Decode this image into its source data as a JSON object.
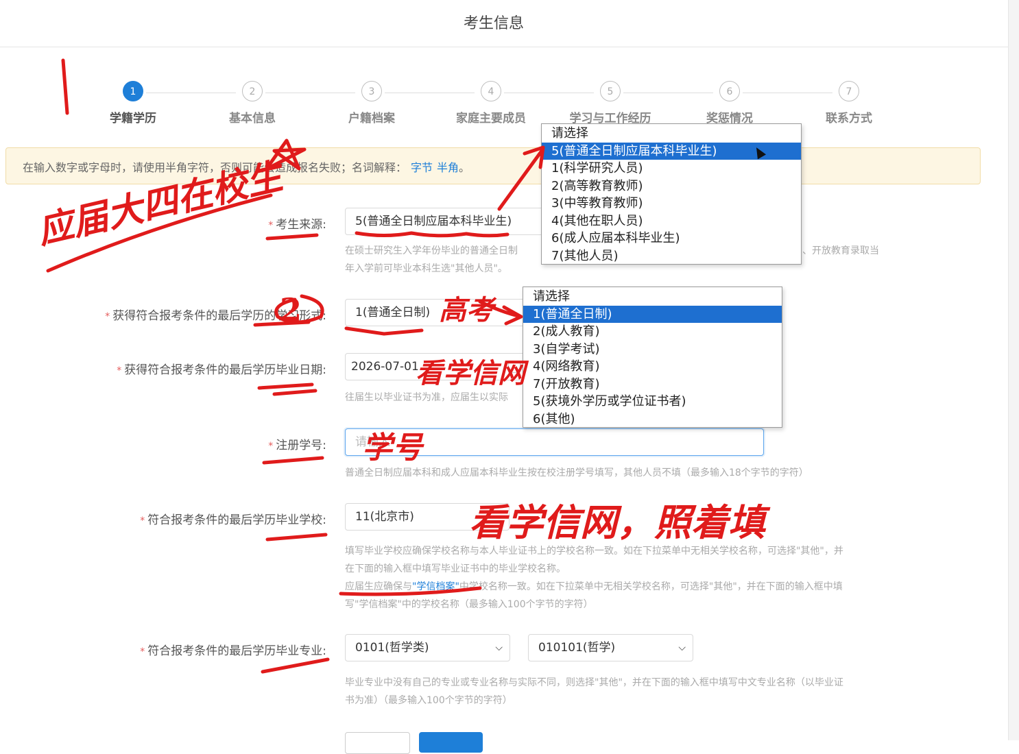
{
  "header": {
    "title": "考生信息"
  },
  "steps": [
    {
      "num": "1",
      "label": "学籍学历",
      "active": true
    },
    {
      "num": "2",
      "label": "基本信息",
      "active": false
    },
    {
      "num": "3",
      "label": "户籍档案",
      "active": false
    },
    {
      "num": "4",
      "label": "家庭主要成员",
      "active": false
    },
    {
      "num": "5",
      "label": "学习与工作经历",
      "active": false
    },
    {
      "num": "6",
      "label": "奖惩情况",
      "active": false
    },
    {
      "num": "7",
      "label": "联系方式",
      "active": false
    }
  ],
  "notice": {
    "text": "在输入数字或字母时，请使用半角字符，否则可能会造成报名失败；名词解释：",
    "link1": "字节",
    "link2": "半角",
    "end": "。"
  },
  "form": {
    "source": {
      "label": "考生来源:",
      "value": "5(普通全日制应届本科毕业生)",
      "hint_line1": "在硕士研究生入学年份毕业的普通全日制",
      "hint_line1_tail": "、开放教育录取当",
      "hint_line2": "年入学前可毕业本科生选\"其他人员\"。"
    },
    "study_form": {
      "label": "获得符合报考条件的最后学历的学习形式:",
      "value": "1(普通全日制)"
    },
    "grad_date": {
      "label": "获得符合报考条件的最后学历毕业日期:",
      "value": "2026-07-01",
      "hint": "往届生以毕业证书为准，应届生以实际"
    },
    "reg_no": {
      "label": "注册学号:",
      "placeholder": "请输入",
      "hint": "普通全日制应届本科和成人应届本科毕业生按在校注册学号填写，其他人员不填（最多输入18个字节的字符）"
    },
    "school": {
      "label": "符合报考条件的最后学历毕业学校:",
      "value": "11(北京市)",
      "hint_line1": "填写毕业学校应确保学校名称与本人毕业证书上的学校名称一致。如在下拉菜单中无相关学校名称，可选择\"其他\"，并",
      "hint_line2": "在下面的输入框中填写毕业证书中的毕业学校名称。",
      "hint_line3_pre": "应届生应确保与",
      "hint_line3_link": "\"学信档案\"",
      "hint_line3_post": "中学校名称一致。如在下拉菜单中无相关学校名称，可选择\"其他\"，并在下面的输入框中填",
      "hint_line4": "写\"学信档案\"中的学校名称（最多输入100个字节的字符）"
    },
    "major": {
      "label": "符合报考条件的最后学历毕业专业:",
      "value1": "0101(哲学类)",
      "value2": "010101(哲学)",
      "hint_line1": "毕业专业中没有自己的专业或专业名称与实际不同，则选择\"其他\"，并在下面的输入框中填写中文专业名称（以毕业证",
      "hint_line2": "书为准）（最多输入100个字节的字符）"
    },
    "required_mark": "*"
  },
  "dropdown_source": {
    "options": [
      "请选择",
      "5(普通全日制应届本科毕业生)",
      "1(科学研究人员)",
      "2(高等教育教师)",
      "3(中等教育教师)",
      "4(其他在职人员)",
      "6(成人应届本科毕业生)",
      "7(其他人员)"
    ],
    "selected_index": 1
  },
  "dropdown_study": {
    "options": [
      "请选择",
      "1(普通全日制)",
      "2(成人教育)",
      "3(自学考试)",
      "4(网络教育)",
      "7(开放教育)",
      "5(获境外学历或学位证书者)",
      "6(其他)"
    ],
    "selected_index": 1
  },
  "annotations": {
    "n1": "1",
    "n2": "2",
    "a1": "应届大四在校生",
    "a2": "高考",
    "a3": "看学信网",
    "a4": "学号",
    "a5": "看学信网，照着填",
    "ink_color": "#e01b1b"
  },
  "colors": {
    "primary": "#1e7fd8",
    "notice_bg": "#fdf6e3",
    "selected": "#1e6fd0"
  }
}
